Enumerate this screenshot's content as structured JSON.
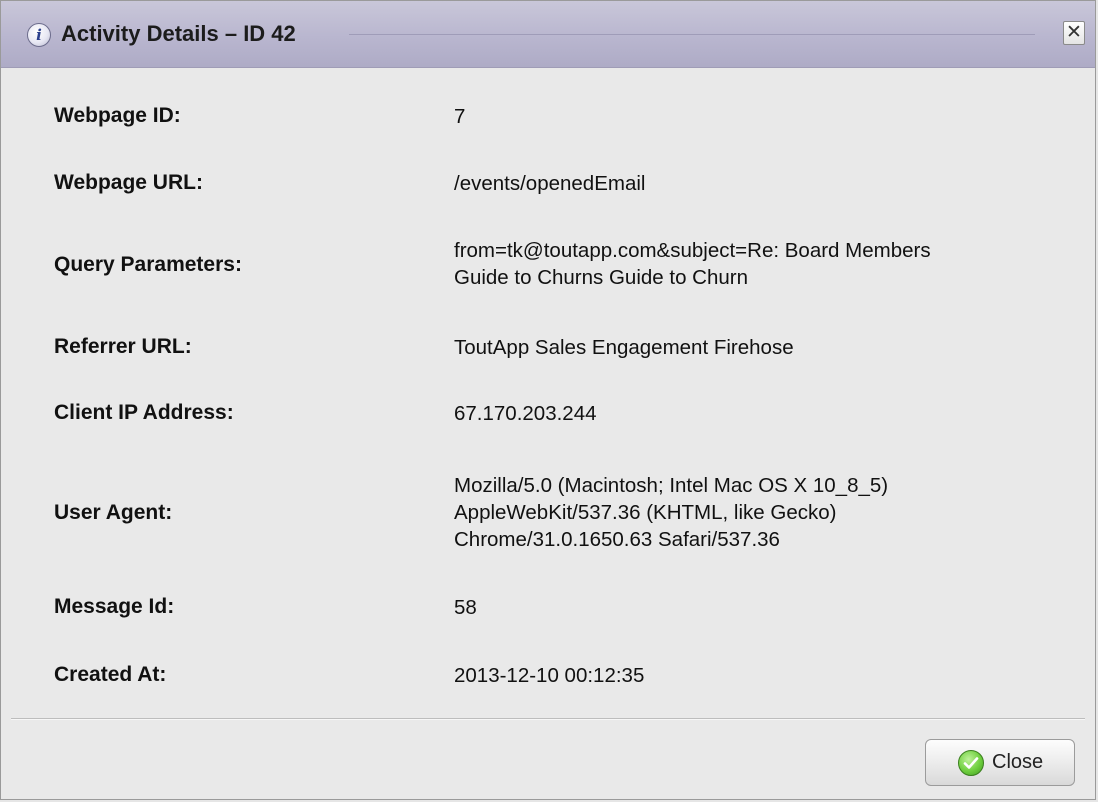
{
  "dialog": {
    "title": "Activity Details – ID 42",
    "close_x": "✕",
    "info_glyph": "i"
  },
  "details": [
    {
      "label": "Webpage ID:",
      "value": [
        "7"
      ]
    },
    {
      "label": "Webpage URL:",
      "value": [
        "/events/openedEmail"
      ]
    },
    {
      "label": "Query Parameters:",
      "value": [
        "from=tk@toutapp.com&subject=Re: Board Members",
        "Guide to Churns Guide to Churn"
      ]
    },
    {
      "label": "Referrer URL:",
      "value": [
        "ToutApp Sales Engagement Firehose"
      ]
    },
    {
      "label": "Client IP Address:",
      "value": [
        "67.170.203.244"
      ]
    },
    {
      "label": "User Agent:",
      "value": [
        "Mozilla/5.0 (Macintosh; Intel Mac OS X 10_8_5)",
        "AppleWebKit/537.36 (KHTML, like Gecko)",
        "Chrome/31.0.1650.63 Safari/537.36"
      ]
    },
    {
      "label": "Message Id:",
      "value": [
        "58"
      ]
    },
    {
      "label": "Created At:",
      "value": [
        "2013-12-10 00:12:35"
      ]
    }
  ],
  "footer": {
    "close_label": "Close"
  },
  "icons": {
    "title_icon": "info-icon",
    "close_icon": "close-icon",
    "button_icon": "checkmark-icon"
  },
  "colors": {
    "titlebar": "#b9b6cf",
    "body": "#e9e9e9",
    "check_green": "#6fcf3f"
  }
}
